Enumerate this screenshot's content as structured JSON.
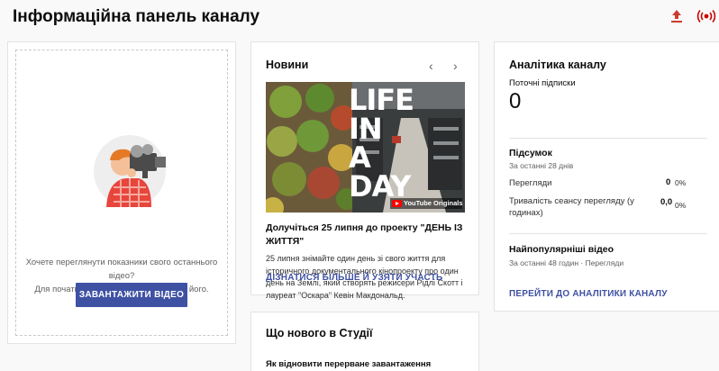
{
  "header": {
    "title": "Інформаційна панель каналу",
    "upload_icon": "upload-icon",
    "live_icon": "go-live-icon"
  },
  "upload_card": {
    "illustration": "video-camera-person-illustration",
    "prompt_line1": "Хочете переглянути показники свого останнього відео?",
    "prompt_line2": "Для початку завантажте й опублікуйте його.",
    "button_label": "ЗАВАНТАЖИТИ ВІДЕО"
  },
  "news_card": {
    "title": "Новини",
    "prev_icon": "chevron-left-icon",
    "next_icon": "chevron-right-icon",
    "image_text_line1": "LIFE",
    "image_text_line2": "IN A",
    "image_text_line3": "DAY",
    "image_badge": "YouTube Originals",
    "headline": "Долучіться 25 липня до проекту \"ДЕНЬ ІЗ ЖИТТЯ\"",
    "body": "25 липня знімайте один день зі свого життя для історичного документального кінопроекту про один день на Землі, який створять режисери Рідлі Скотт і лауреат \"Оскара\" Кевін Макдональд.",
    "link": "ДІЗНАТИСЯ БІЛЬШЕ Й УЗЯТИ УЧАСТЬ"
  },
  "studio_card": {
    "title": "Що нового в Студії",
    "item": "Як відновити перерване завантаження"
  },
  "analytics_card": {
    "title": "Аналітика каналу",
    "subs_label": "Поточні підписки",
    "subs_value": "0",
    "summary_title": "Підсумок",
    "summary_period": "За останні 28 днів",
    "views_label": "Перегляди",
    "views_value": "0",
    "views_pct": "0%",
    "watch_label": "Тривалість сеансу перегляду (у годинах)",
    "watch_value": "0,0",
    "watch_pct": "0%",
    "popular_title": "Найпопулярніші відео",
    "popular_period": "За останні 48 годин · Перегляди",
    "link": "ПЕРЕЙТИ ДО АНАЛІТИКИ КАНАЛУ"
  },
  "colors": {
    "accent": "#3f51a3",
    "upload_arrow": "#cc3c2e",
    "live": "#cc0000"
  }
}
